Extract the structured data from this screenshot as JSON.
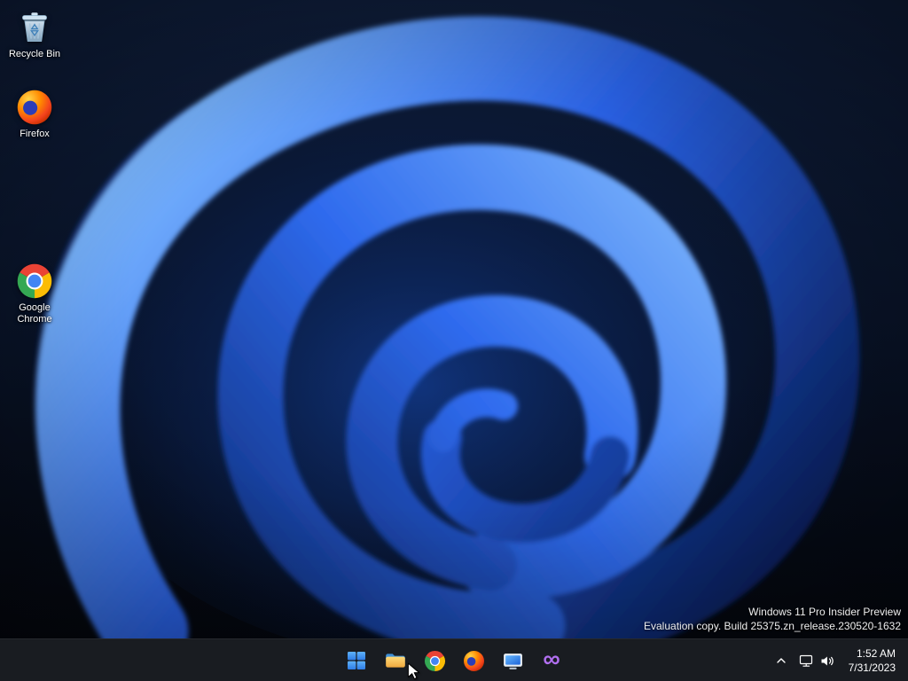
{
  "desktop": {
    "icons": [
      {
        "label": "Recycle Bin",
        "icon": "recycle-bin-icon"
      },
      {
        "label": "Firefox",
        "icon": "firefox-icon"
      },
      {
        "label": "Google Chrome",
        "icon": "chrome-icon"
      }
    ],
    "watermark": {
      "line1": "Windows 11 Pro Insider Preview",
      "line2": "Evaluation copy. Build 25375.zn_release.230520-1632"
    }
  },
  "taskbar": {
    "buttons": [
      {
        "name": "start",
        "icon": "windows-logo-icon"
      },
      {
        "name": "file-explorer",
        "icon": "folder-icon"
      },
      {
        "name": "chrome",
        "icon": "chrome-icon"
      },
      {
        "name": "firefox",
        "icon": "firefox-icon"
      },
      {
        "name": "media-app",
        "icon": "monitor-app-icon"
      },
      {
        "name": "visual-studio",
        "icon": "visual-studio-icon",
        "glyph": "∞"
      }
    ],
    "tray": {
      "chevron_icon": "chevron-up-icon",
      "network_icon": "network-icon",
      "volume_icon": "volume-icon",
      "time": "1:52 AM",
      "date": "7/31/2023"
    }
  },
  "colors": {
    "taskbar_bg": "#1a1d22",
    "bloom_blue": "#2a63e8",
    "label_text": "#ffffff"
  }
}
